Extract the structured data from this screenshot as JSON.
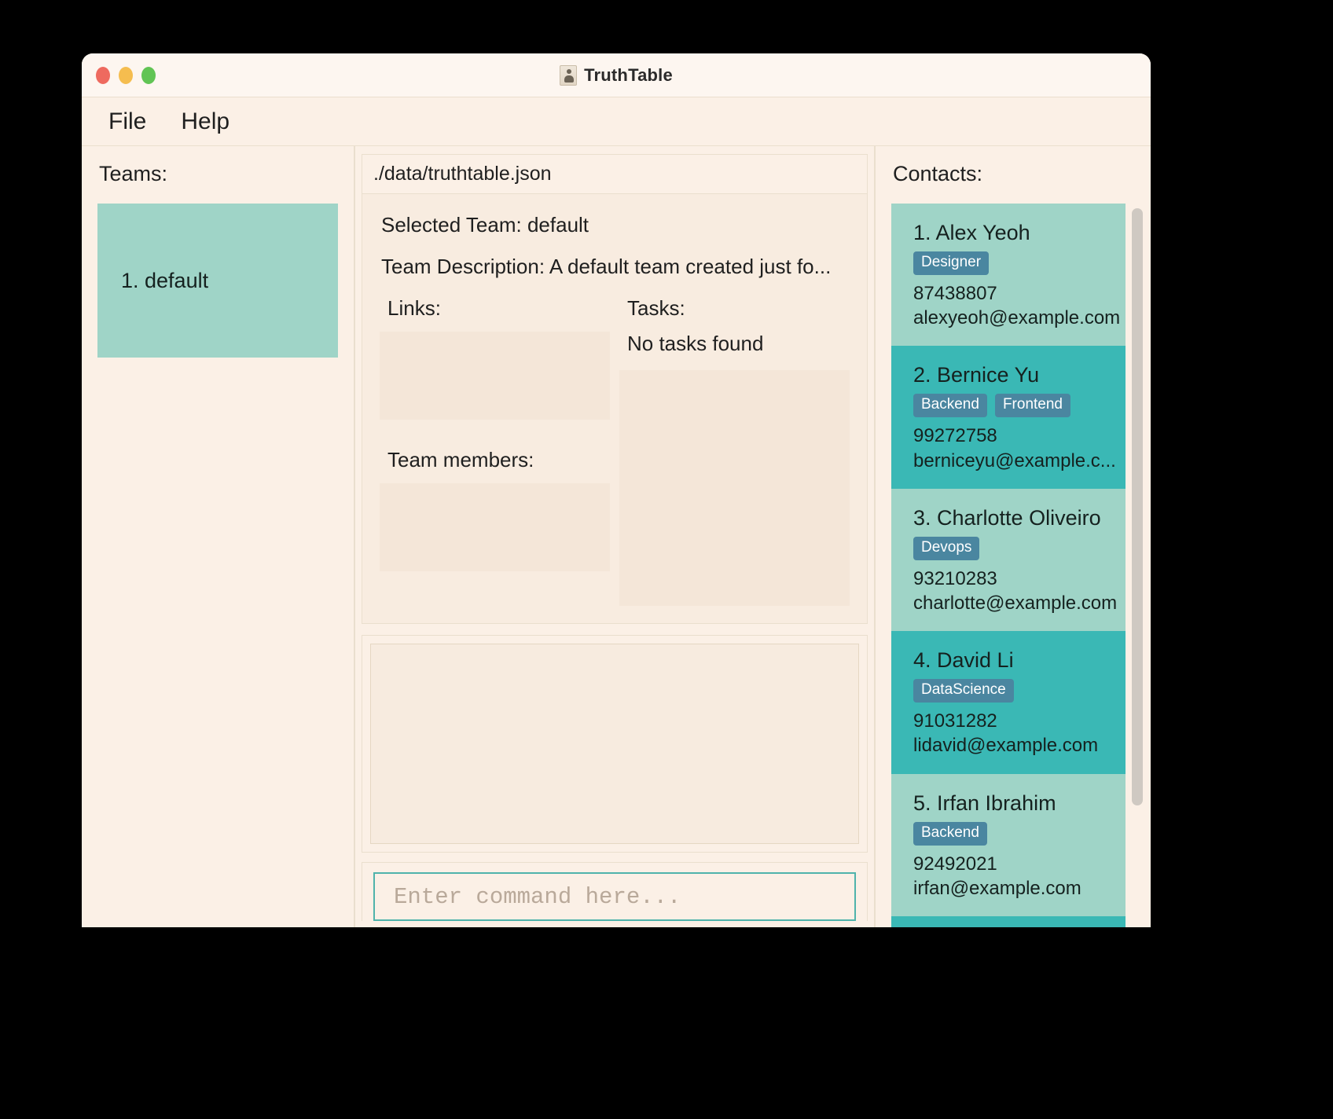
{
  "window": {
    "title": "TruthTable",
    "app_icon": "contact-card-icon",
    "traffic_lights": [
      "close-button",
      "minimize-button",
      "maximize-button"
    ],
    "colors": {
      "window_bg": "#fbf0e6",
      "titlebar_bg": "#fdf6f0",
      "border": "#eadfce",
      "accent_light": "#9fd4c7",
      "accent_dark": "#3ab8b5",
      "tag_bg": "#4a86a0",
      "input_border": "#4fb3ab",
      "close": "#ee6a5f",
      "minimize": "#f5bd4f",
      "maximize": "#61c454"
    }
  },
  "menu": {
    "items": [
      {
        "label": "File"
      },
      {
        "label": "Help"
      }
    ]
  },
  "teams_panel": {
    "heading": "Teams:",
    "items": [
      {
        "label": "1. default",
        "selected": true
      }
    ]
  },
  "center_panel": {
    "file_path": "./data/truthtable.json",
    "selected_team_line": "Selected Team: default",
    "team_description_line": "Team Description: A default team created just fo...",
    "links_heading": "Links:",
    "tasks_heading": "Tasks:",
    "tasks_empty_message": "No tasks found",
    "team_members_heading": "Team members:",
    "links_items": [],
    "tasks_items": [],
    "team_members_items": [],
    "output_text": "",
    "command_input": {
      "value": "",
      "placeholder": "Enter command here..."
    }
  },
  "contacts_panel": {
    "heading": "Contacts:",
    "scrollbar": "vertical-scrollbar",
    "items": [
      {
        "name": "1. Alex Yeoh",
        "tags": [
          "Designer"
        ],
        "phone": "87438807",
        "email": "alexyeoh@example.com",
        "shade": "light"
      },
      {
        "name": "2. Bernice Yu",
        "tags": [
          "Backend",
          "Frontend"
        ],
        "phone": "99272758",
        "email": "berniceyu@example.c...",
        "shade": "dark"
      },
      {
        "name": "3. Charlotte Oliveiro",
        "tags": [
          "Devops"
        ],
        "phone": "93210283",
        "email": "charlotte@example.com",
        "shade": "light"
      },
      {
        "name": "4. David Li",
        "tags": [
          "DataScience"
        ],
        "phone": "91031282",
        "email": "lidavid@example.com",
        "shade": "dark"
      },
      {
        "name": "5. Irfan Ibrahim",
        "tags": [
          "Backend"
        ],
        "phone": "92492021",
        "email": "irfan@example.com",
        "shade": "light"
      },
      {
        "name": "",
        "tags": [],
        "phone": "",
        "email": "",
        "shade": "dark"
      }
    ]
  }
}
